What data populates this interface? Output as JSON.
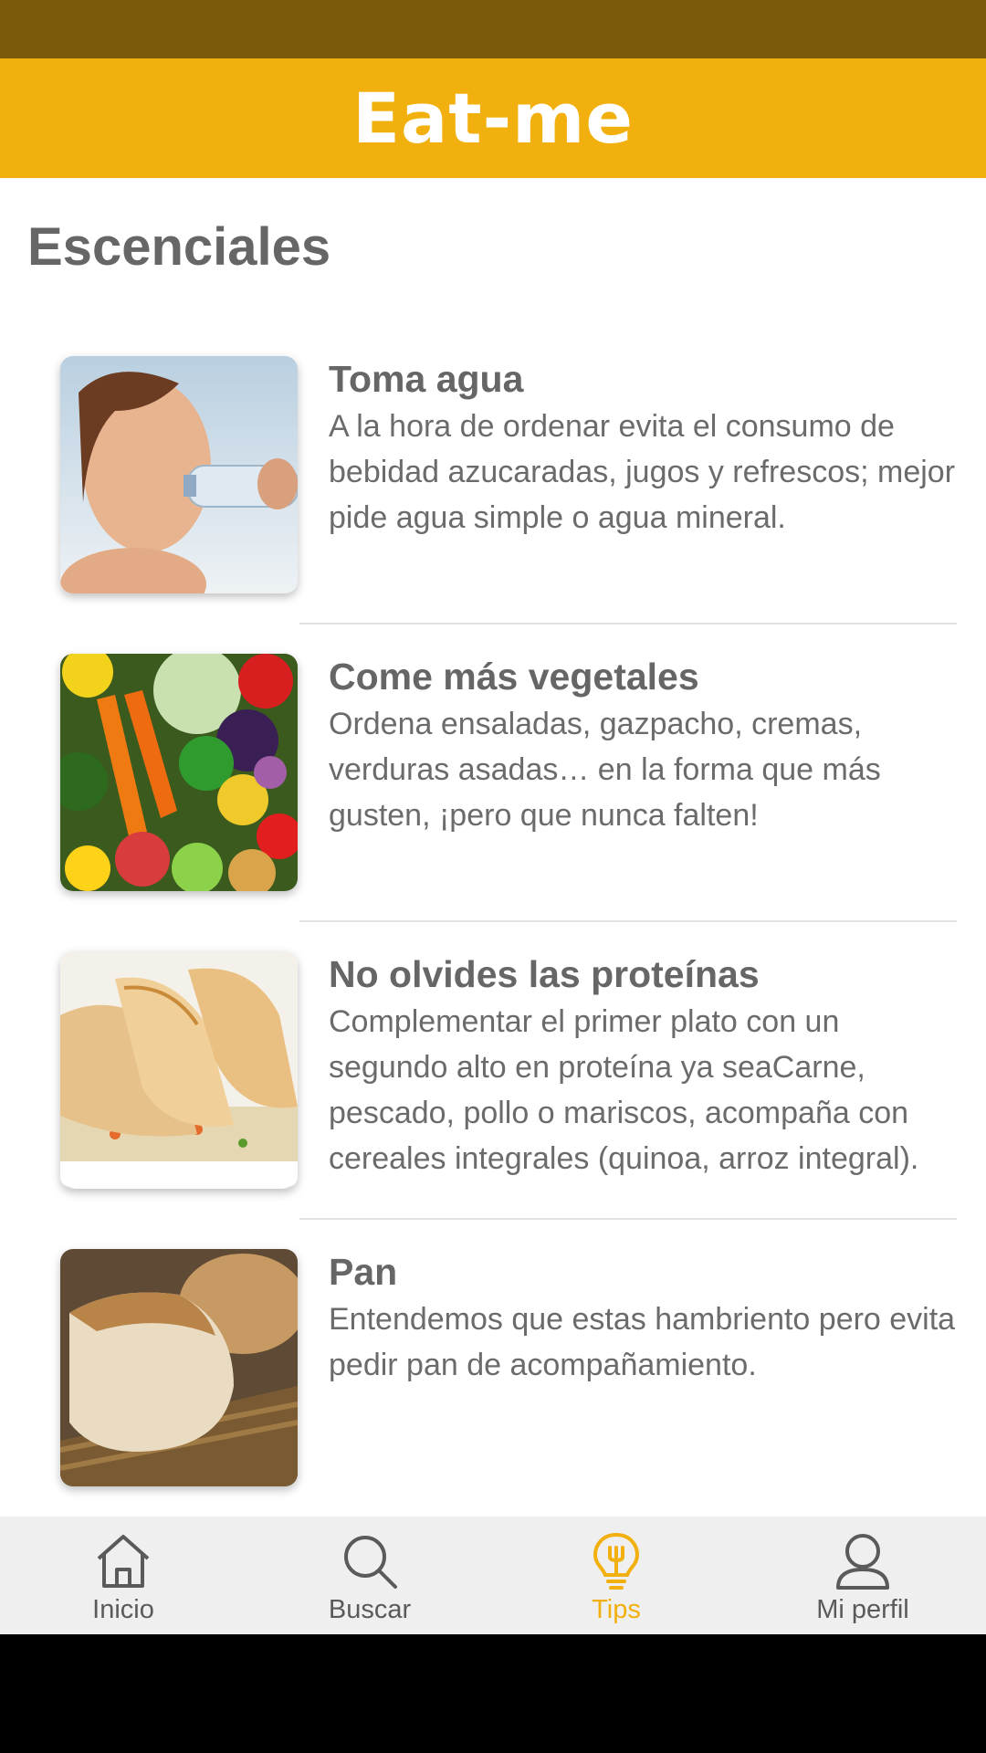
{
  "app": {
    "title": "Eat-me"
  },
  "colors": {
    "accent": "#f2b00e",
    "status_bar": "#7a5a0a",
    "text_gray": "#666666"
  },
  "section": {
    "title": "Escenciales"
  },
  "tips": [
    {
      "title": "Toma agua",
      "body": "A la hora de ordenar evita el consumo de bebidad azucaradas, jugos y refrescos; mejor pide agua simple o agua mineral.",
      "image": "woman-drinking-water-photo"
    },
    {
      "title": "Come más vegetales",
      "body": "Ordena ensaladas, gazpacho, cremas, verduras asadas… en la forma que más gusten, ¡pero que nunca falten!",
      "image": "assorted-vegetables-photo"
    },
    {
      "title": "No olvides las proteínas",
      "body": "Complementar el primer plato con un segundo alto en proteína ya seaCarne, pescado, pollo o mariscos, acompaña con cereales integrales (quinoa, arroz integral).",
      "image": "chicken-with-rice-photo"
    },
    {
      "title": "Pan",
      "body": "Entendemos que estas hambriento pero evita pedir pan de acompañamiento.",
      "image": "bread-basket-photo"
    }
  ],
  "tabbar": {
    "items": [
      {
        "label": "Inicio",
        "icon": "home-icon",
        "active": false
      },
      {
        "label": "Buscar",
        "icon": "search-icon",
        "active": false
      },
      {
        "label": "Tips",
        "icon": "lightbulb-icon",
        "active": true
      },
      {
        "label": "Mi perfil",
        "icon": "user-icon",
        "active": false
      }
    ]
  }
}
